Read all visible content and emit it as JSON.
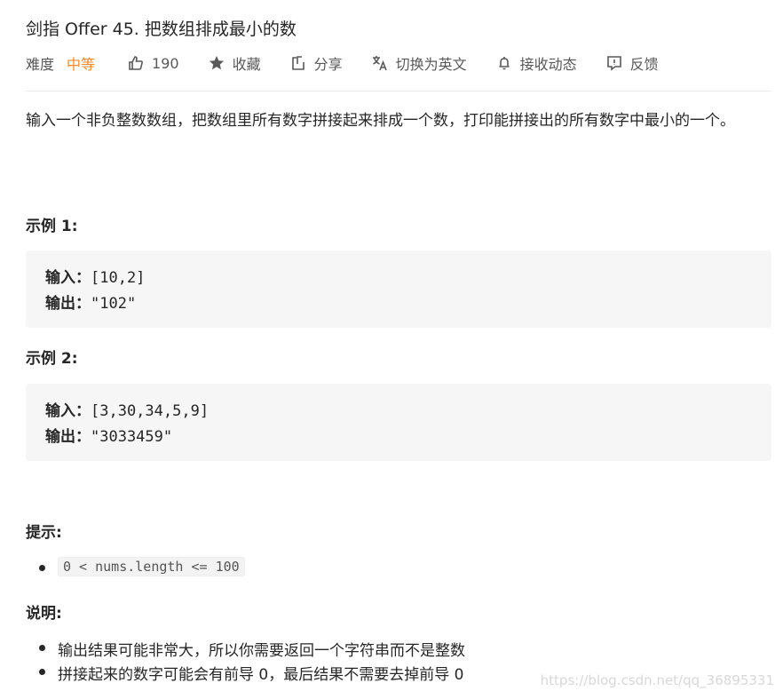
{
  "title": "剑指 Offer 45. 把数组排成最小的数",
  "meta": {
    "difficulty_label": "难度",
    "difficulty_value": "中等",
    "likes": "190",
    "favorite": "收藏",
    "share": "分享",
    "translate": "切换为英文",
    "subscribe": "接收动态",
    "feedback": "反馈",
    "difficulty_color": "#ef8a2e"
  },
  "description": "输入一个非负整数数组，把数组里所有数字拼接起来排成一个数，打印能拼接出的所有数字中最小的一个。",
  "examples": [
    {
      "heading": "示例 1:",
      "input_label": "输入：",
      "input_value": "[10,2]",
      "output_label": "输出：",
      "output_value": "\"102\""
    },
    {
      "heading": "示例 2:",
      "input_label": "输入：",
      "input_value": "[3,30,34,5,9]",
      "output_label": "输出：",
      "output_value": "\"3033459\""
    }
  ],
  "hints": {
    "heading": "提示:",
    "items": [
      "0 < nums.length <= 100"
    ]
  },
  "notes": {
    "heading": "说明:",
    "items": [
      "输出结果可能非常大，所以你需要返回一个字符串而不是整数",
      "拼接起来的数字可能会有前导 0，最后结果不需要去掉前导 0"
    ]
  },
  "watermark": "https://blog.csdn.net/qq_36895331"
}
